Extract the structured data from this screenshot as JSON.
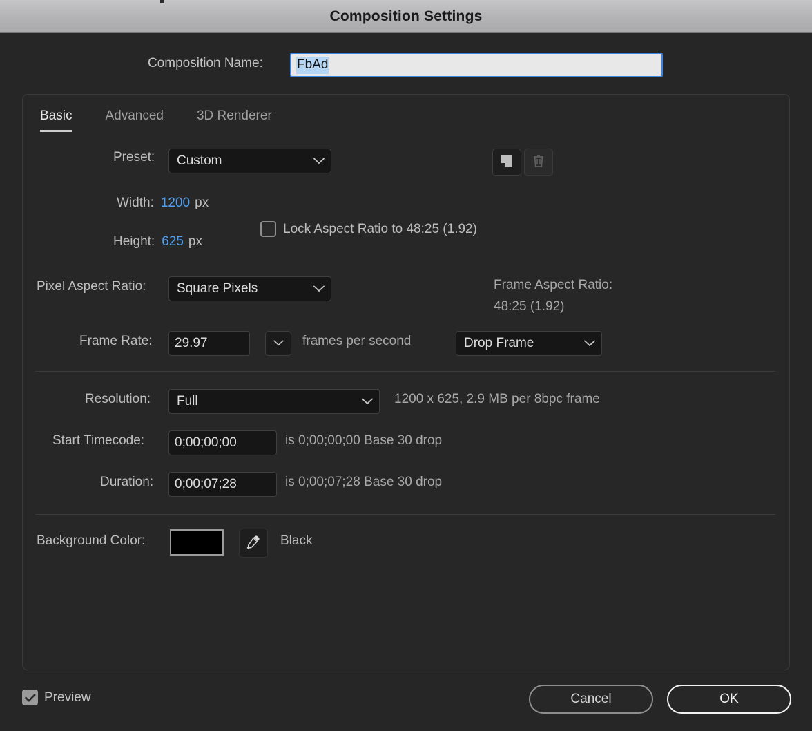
{
  "window": {
    "title": "Composition Settings"
  },
  "composition_name": {
    "label": "Composition Name:",
    "value": "FbAd"
  },
  "tabs": [
    {
      "label": "Basic",
      "active": true
    },
    {
      "label": "Advanced",
      "active": false
    },
    {
      "label": "3D Renderer",
      "active": false
    }
  ],
  "basic": {
    "preset": {
      "label": "Preset:",
      "value": "Custom",
      "save_icon": "save-preset-icon",
      "delete_icon": "trash-icon"
    },
    "width": {
      "label": "Width:",
      "value": "1200",
      "unit": "px"
    },
    "height": {
      "label": "Height:",
      "value": "625",
      "unit": "px"
    },
    "lock_aspect": {
      "label": "Lock Aspect Ratio to 48:25 (1.92)",
      "checked": false
    },
    "pixel_aspect_ratio": {
      "label": "Pixel Aspect Ratio:",
      "value": "Square Pixels"
    },
    "frame_aspect_ratio": {
      "label": "Frame Aspect Ratio:",
      "value": "48:25 (1.92)"
    },
    "frame_rate": {
      "label": "Frame Rate:",
      "value": "29.97",
      "unit": "frames per second",
      "drop_frame": "Drop Frame"
    },
    "resolution": {
      "label": "Resolution:",
      "value": "Full",
      "info": "1200 x 625, 2.9 MB per 8bpc frame"
    },
    "start_timecode": {
      "label": "Start Timecode:",
      "value": "0;00;00;00",
      "info": "is 0;00;00;00  Base 30  drop"
    },
    "duration": {
      "label": "Duration:",
      "value": "0;00;07;28",
      "info": "is 0;00;07;28  Base 30  drop"
    },
    "background_color": {
      "label": "Background Color:",
      "swatch_hex": "#000000",
      "name": "Black",
      "eyedropper_icon": "eyedropper-icon"
    }
  },
  "footer": {
    "preview": {
      "label": "Preview",
      "checked": true
    },
    "cancel_label": "Cancel",
    "ok_label": "OK"
  },
  "colors": {
    "accent_blue": "#4ea1f5",
    "dialog_bg": "#262626",
    "titlebar_top": "#c6c6c8",
    "field_bg": "#161616",
    "input_focus_border": "#3c86e0"
  }
}
